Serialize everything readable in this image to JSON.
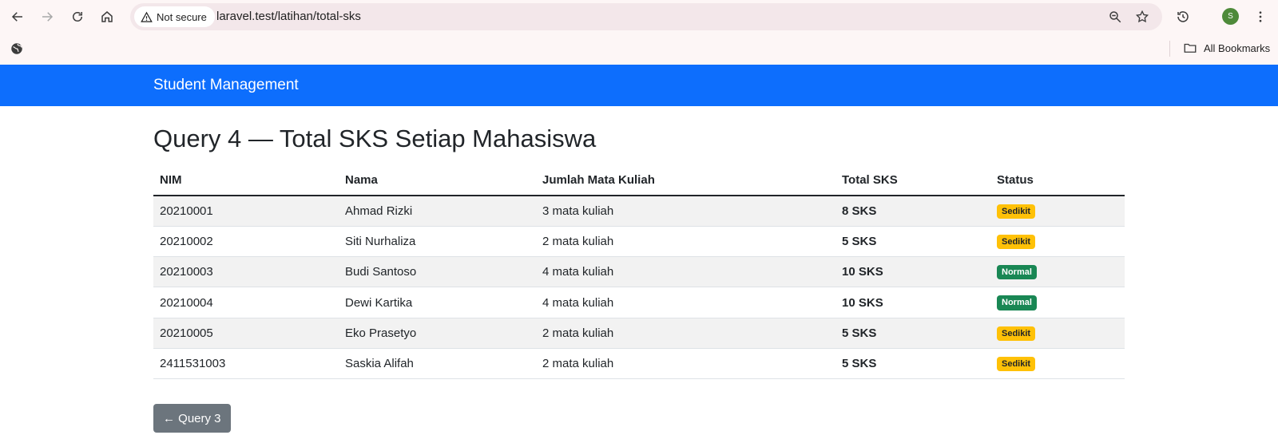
{
  "browser": {
    "security_label": "Not secure",
    "url": "laravel.test/latihan/total-sks",
    "avatar_letter": "S",
    "bookmarks_label": "All Bookmarks"
  },
  "navbar": {
    "brand": "Student Management"
  },
  "page": {
    "title": "Query 4 — Total SKS Setiap Mahasiswa"
  },
  "table": {
    "headers": {
      "nim": "NIM",
      "nama": "Nama",
      "jumlah": "Jumlah Mata Kuliah",
      "total": "Total SKS",
      "status": "Status"
    },
    "rows": [
      {
        "nim": "20210001",
        "nama": "Ahmad Rizki",
        "jumlah": "3 mata kuliah",
        "total": "8 SKS",
        "status": "Sedikit"
      },
      {
        "nim": "20210002",
        "nama": "Siti Nurhaliza",
        "jumlah": "2 mata kuliah",
        "total": "5 SKS",
        "status": "Sedikit"
      },
      {
        "nim": "20210003",
        "nama": "Budi Santoso",
        "jumlah": "4 mata kuliah",
        "total": "10 SKS",
        "status": "Normal"
      },
      {
        "nim": "20210004",
        "nama": "Dewi Kartika",
        "jumlah": "4 mata kuliah",
        "total": "10 SKS",
        "status": "Normal"
      },
      {
        "nim": "20210005",
        "nama": "Eko Prasetyo",
        "jumlah": "2 mata kuliah",
        "total": "5 SKS",
        "status": "Sedikit"
      },
      {
        "nim": "2411531003",
        "nama": "Saskia Alifah",
        "jumlah": "2 mata kuliah",
        "total": "5 SKS",
        "status": "Sedikit"
      }
    ]
  },
  "footer": {
    "back_label": "← Query 3"
  },
  "colors": {
    "navbar": "#0d6efd",
    "badge_sedikit": "#ffc107",
    "badge_normal": "#198754",
    "button": "#6c757d"
  },
  "icons": [
    "back-arrow-icon",
    "forward-arrow-icon",
    "reload-icon",
    "home-icon",
    "warning-icon",
    "zoom-icon",
    "star-icon",
    "history-icon",
    "more-icon",
    "globe-icon",
    "folder-icon"
  ]
}
